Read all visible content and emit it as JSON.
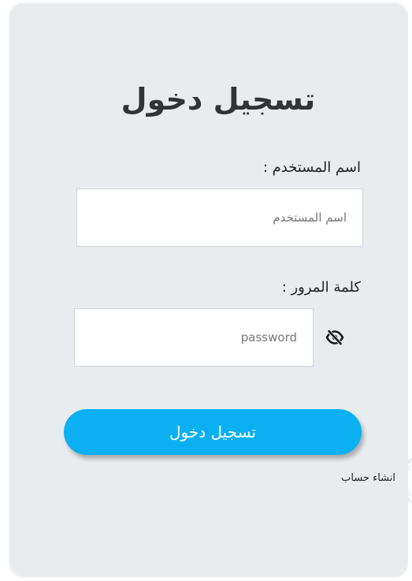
{
  "login": {
    "title": "تسجيل دخول",
    "username": {
      "label": "اسم المستخدم :",
      "placeholder": "اسم المستخدم",
      "value": ""
    },
    "password": {
      "label": "كلمة المرور :",
      "placeholder": "password",
      "value": ""
    },
    "password_toggle_icon": "eye-slash-icon",
    "submit_label": "تسجيل دخول",
    "signup_link": "انشاء حساب"
  },
  "colors": {
    "card_background": "#e9ecef",
    "accent_button": "#0ab0f2",
    "title_text": "#333333"
  }
}
